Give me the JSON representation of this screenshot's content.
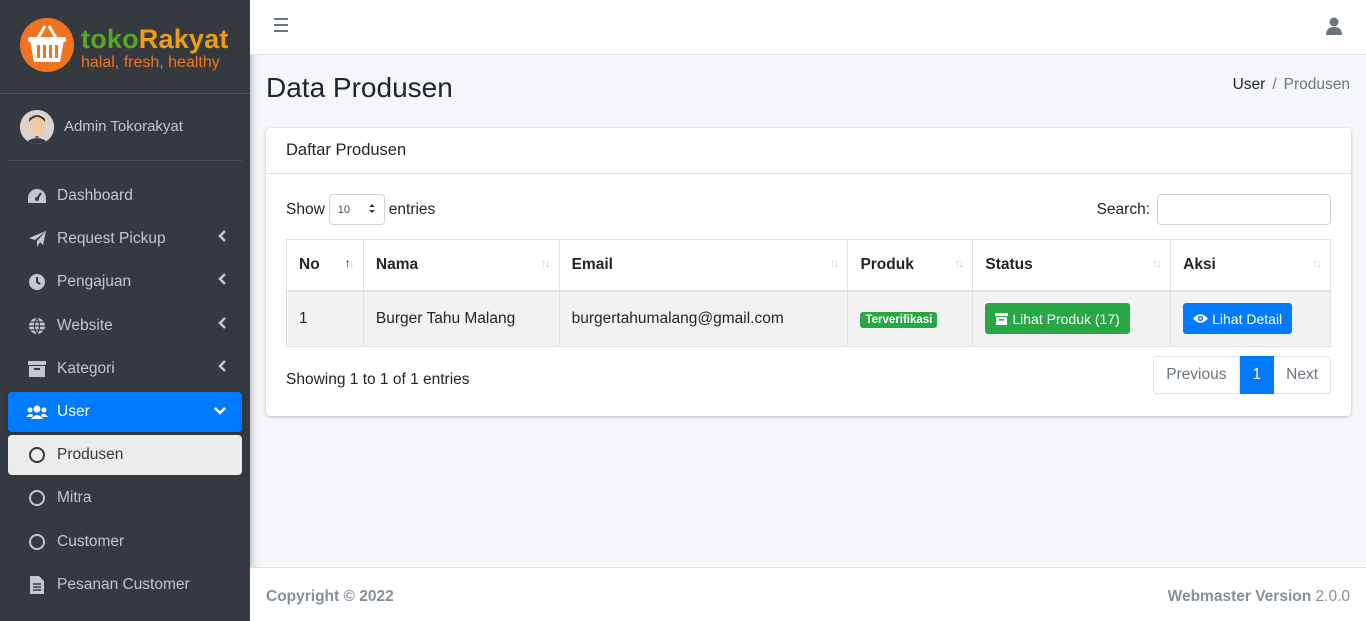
{
  "brand": {
    "name_part1": "toko",
    "name_part2": "Rakyat",
    "tagline": "halal, fresh, healthy"
  },
  "user_panel": {
    "name": "Admin Tokorakyat"
  },
  "sidebar": {
    "items": [
      {
        "label": "Dashboard",
        "icon": "tachometer-icon"
      },
      {
        "label": "Request Pickup",
        "icon": "paper-plane-icon"
      },
      {
        "label": "Pengajuan",
        "icon": "clock-icon"
      },
      {
        "label": "Website",
        "icon": "globe-icon"
      },
      {
        "label": "Kategori",
        "icon": "archive-icon"
      },
      {
        "label": "User",
        "icon": "users-icon"
      },
      {
        "label": "Produsen",
        "icon": "circle-icon"
      },
      {
        "label": "Mitra",
        "icon": "circle-icon"
      },
      {
        "label": "Customer",
        "icon": "circle-icon"
      },
      {
        "label": "Pesanan Customer",
        "icon": "file-icon"
      }
    ]
  },
  "page": {
    "title": "Data Produsen"
  },
  "breadcrumb": {
    "parent": "User",
    "separator": "/",
    "current": "Produsen"
  },
  "card": {
    "title": "Daftar Produsen",
    "show_label": "Show",
    "entries_label": "entries",
    "page_length": "10",
    "search_label": "Search:",
    "search_value": ""
  },
  "table": {
    "columns": [
      "No",
      "Nama",
      "Email",
      "Produk",
      "Status",
      "Aksi"
    ],
    "rows": [
      {
        "no": "1",
        "nama": "Burger Tahu Malang",
        "email": "burgertahumalang@gmail.com",
        "produk": "Terverifikasi",
        "status_button": "Lihat Produk (17)",
        "action_button": "Lihat Detail"
      }
    ]
  },
  "pagination": {
    "info": "Showing 1 to 1 of 1 entries",
    "previous": "Previous",
    "current": "1",
    "next": "Next"
  },
  "footer": {
    "copyright": "Copyright © 2022",
    "version_label": "Webmaster Version",
    "version": "2.0.0"
  },
  "colors": {
    "sidebar": "#343a40",
    "primary": "#007bff",
    "success": "#28a745",
    "brand_green": "#5aa524",
    "brand_orange": "#f0741f"
  }
}
